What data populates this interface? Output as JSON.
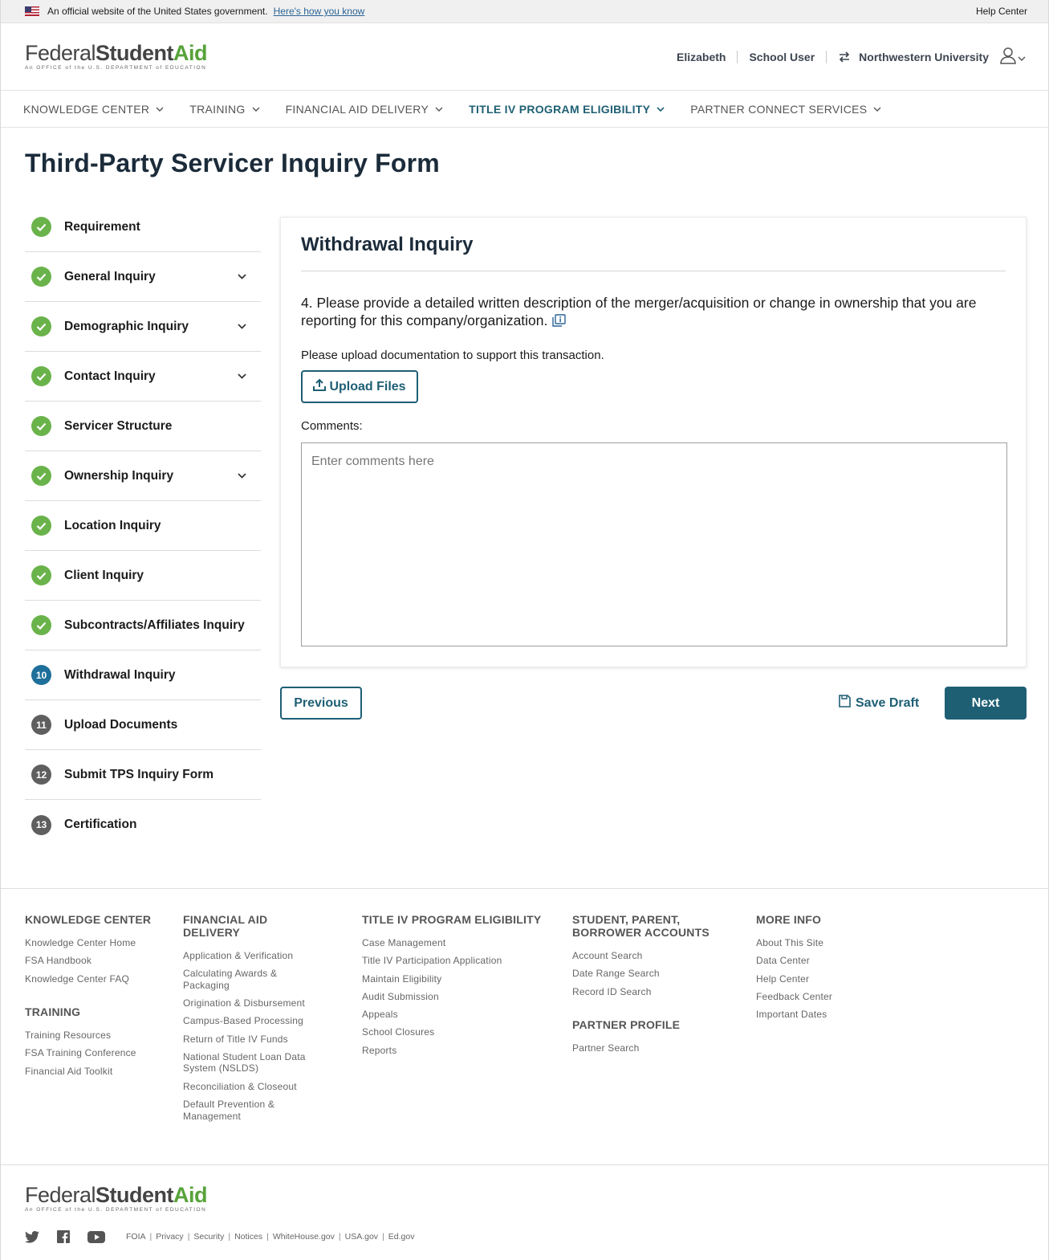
{
  "banner": {
    "official_text": "An official website of the United States government.",
    "how_know": "Here's how you know",
    "help_center": "Help Center"
  },
  "logo": {
    "federal": "Federal",
    "student": "Student",
    "aid": "Aid",
    "tagline": "An OFFICE of the U.S. DEPARTMENT of EDUCATION"
  },
  "user": {
    "name": "Elizabeth",
    "role": "School User",
    "institution": "Northwestern University"
  },
  "nav": [
    {
      "label": "KNOWLEDGE CENTER"
    },
    {
      "label": "TRAINING"
    },
    {
      "label": "FINANCIAL AID DELIVERY"
    },
    {
      "label": "TITLE IV PROGRAM ELIGIBILITY"
    },
    {
      "label": "PARTNER CONNECT SERVICES"
    }
  ],
  "page": {
    "title": "Third-Party Servicer Inquiry Form"
  },
  "steps": [
    {
      "label": "Requirement"
    },
    {
      "label": "General Inquiry"
    },
    {
      "label": "Demographic Inquiry"
    },
    {
      "label": "Contact Inquiry"
    },
    {
      "label": "Servicer Structure"
    },
    {
      "label": "Ownership Inquiry"
    },
    {
      "label": "Location Inquiry"
    },
    {
      "label": "Client Inquiry"
    },
    {
      "label": "Subcontracts/Affiliates Inquiry"
    },
    {
      "label": "Withdrawal Inquiry",
      "number": "10"
    },
    {
      "label": "Upload Documents",
      "number": "11"
    },
    {
      "label": "Submit TPS Inquiry Form",
      "number": "12"
    },
    {
      "label": "Certification",
      "number": "13"
    }
  ],
  "form": {
    "section_title": "Withdrawal Inquiry",
    "question": "4. Please provide a detailed written description of the merger/acquisition or change in ownership that you are reporting for this company/organization.",
    "upload_note": "Please upload documentation to support this transaction.",
    "upload_label": "Upload Files",
    "comments_label": "Comments:",
    "comments_placeholder": "Enter comments here",
    "comments_value": ""
  },
  "actions": {
    "previous": "Previous",
    "save_draft": "Save Draft",
    "next": "Next"
  },
  "footer": {
    "knowledge_center": {
      "heading": "KNOWLEDGE CENTER",
      "links": [
        "Knowledge Center Home",
        "FSA Handbook",
        "Knowledge Center FAQ"
      ]
    },
    "training": {
      "heading": "TRAINING",
      "links": [
        "Training Resources",
        "FSA Training Conference",
        "Financial Aid Toolkit"
      ]
    },
    "financial_aid_delivery": {
      "heading": "FINANCIAL AID DELIVERY",
      "links": [
        "Application & Verification",
        "Calculating Awards & Packaging",
        "Origination & Disbursement",
        "Campus-Based Processing",
        "Return of Title IV Funds",
        "National Student Loan Data System (NSLDS)",
        "Reconciliation & Closeout",
        "Default Prevention & Management"
      ]
    },
    "title_iv": {
      "heading": "TITLE IV PROGRAM ELIGIBILITY",
      "links": [
        "Case Management",
        "Title IV Participation Application",
        "Maintain Eligibility",
        "Audit Submission",
        "Appeals",
        "School Closures",
        "Reports"
      ]
    },
    "accounts": {
      "heading": "STUDENT, PARENT, BORROWER ACCOUNTS",
      "links": [
        "Account Search",
        "Date Range Search",
        "Record ID Search"
      ]
    },
    "partner_profile": {
      "heading": "PARTNER PROFILE",
      "links": [
        "Partner Search"
      ]
    },
    "more_info": {
      "heading": "MORE INFO",
      "links": [
        "About This Site",
        "Data Center",
        "Help Center",
        "Feedback Center",
        "Important Dates"
      ]
    },
    "legal": [
      "FOIA",
      "Privacy",
      "Security",
      "Notices",
      "WhiteHouse.gov",
      "USA.gov",
      "Ed.gov"
    ],
    "social_icons": [
      "twitter-icon",
      "facebook-icon",
      "youtube-icon"
    ]
  },
  "colors": {
    "primary": "#1e5f74",
    "done": "#6ab34b",
    "current": "#1e6f9a",
    "todo": "#5f5f5f",
    "logo_green": "#57a33a"
  }
}
